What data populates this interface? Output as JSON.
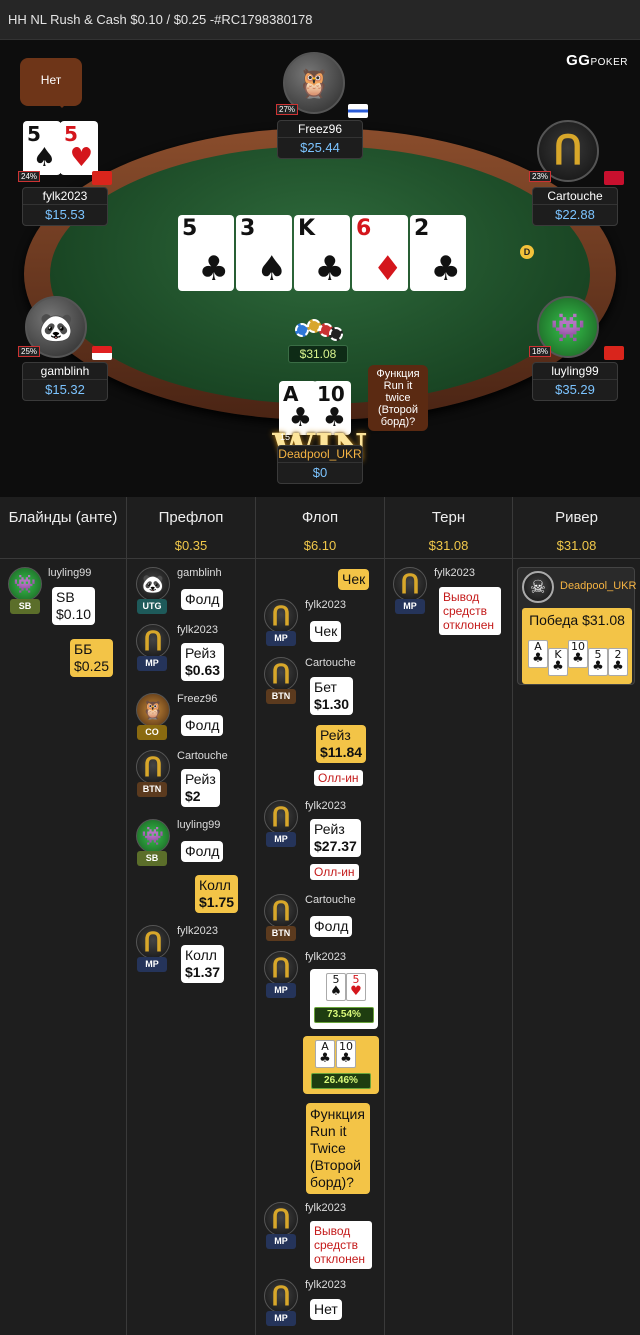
{
  "title": "HH NL Rush & Cash $0.10 / $0.25 -#RC1798380178",
  "logo": {
    "text": "GG",
    "sub": "POKER"
  },
  "bubble_fylk": "Нет",
  "players": {
    "freez": {
      "name": "Freez96",
      "stack": "$25.44",
      "pct": "27%",
      "icon": "owl-icon"
    },
    "fylk": {
      "name": "fylk2023",
      "stack": "$15.53",
      "pct": "24%",
      "cards": [
        {
          "r": "5",
          "s": "♠",
          "red": false
        },
        {
          "r": "5",
          "s": "♥",
          "red": true
        }
      ]
    },
    "cartouche": {
      "name": "Cartouche",
      "stack": "$22.88",
      "pct": "23%",
      "icon": "horseshoe-icon",
      "dealer": "D"
    },
    "gamblinh": {
      "name": "gamblinh",
      "stack": "$15.32",
      "pct": "25%",
      "icon": "panda-icon"
    },
    "luyling": {
      "name": "luyling99",
      "stack": "$35.29",
      "pct": "18%",
      "icon": "alien-icon"
    },
    "deadpool": {
      "name": "Deadpool_UKR",
      "stack": "$0",
      "cards": [
        {
          "r": "A",
          "s": "♣",
          "red": false
        },
        {
          "r": "10",
          "s": "♣",
          "red": false
        }
      ],
      "win": "WIN",
      "win_num": "15"
    }
  },
  "board": [
    {
      "r": "5",
      "s": "♣",
      "red": false
    },
    {
      "r": "3",
      "s": "♠",
      "red": false
    },
    {
      "r": "K",
      "s": "♣",
      "red": false
    },
    {
      "r": "6",
      "s": "♦",
      "red": true
    },
    {
      "r": "2",
      "s": "♣",
      "red": false
    }
  ],
  "pot": "$31.08",
  "rit_bubble": "Функция Run it twice (Второй борд)?",
  "streets": [
    {
      "label": "Блайнды (анте)",
      "amt": ""
    },
    {
      "label": "Префлоп",
      "amt": "$0.35"
    },
    {
      "label": "Флоп",
      "amt": "$6.10"
    },
    {
      "label": "Терн",
      "amt": "$31.08"
    },
    {
      "label": "Ривер",
      "amt": "$31.08"
    }
  ],
  "blinds": {
    "luyling": {
      "name": "luyling99",
      "pos": "SB",
      "action": [
        "SB",
        "$0.10"
      ]
    },
    "bb": [
      "ББ",
      "$0.25"
    ]
  },
  "preflop": [
    {
      "name": "gamblinh",
      "pos": "UTG",
      "action": "Фолд"
    },
    {
      "name": "fylk2023",
      "pos": "MP",
      "action": "Рейз",
      "amount": "$0.63"
    },
    {
      "name": "Freez96",
      "pos": "CO",
      "action": "Фолд"
    },
    {
      "name": "Cartouche",
      "pos": "BTN",
      "action": "Рейз",
      "amount": "$2"
    },
    {
      "name": "luyling99",
      "pos": "SB",
      "action": "Фолд"
    },
    {
      "hero": true,
      "action": "Колл",
      "amount": "$1.75"
    },
    {
      "name": "fylk2023",
      "pos": "MP",
      "action": "Колл",
      "amount": "$1.37"
    }
  ],
  "flop": {
    "hero_check": "Чек",
    "a1": {
      "name": "fylk2023",
      "pos": "MP",
      "action": "Чек"
    },
    "a2": {
      "name": "Cartouche",
      "pos": "BTN",
      "action": "Бет",
      "amount": "$1.30"
    },
    "hero_raise": {
      "action": "Рейз",
      "amount": "$11.84",
      "tag": "Олл-ин"
    },
    "a3": {
      "name": "fylk2023",
      "pos": "MP",
      "action": "Рейз",
      "amount": "$27.37",
      "tag": "Олл-ин"
    },
    "a4": {
      "name": "Cartouche",
      "pos": "BTN",
      "action": "Фолд"
    },
    "show": {
      "name": "fylk2023",
      "pos": "MP",
      "cards": [
        {
          "r": "5",
          "s": "♠",
          "red": false
        },
        {
          "r": "5",
          "s": "♥",
          "red": true
        }
      ],
      "eq": "73.54%"
    },
    "hero_show": {
      "cards": [
        {
          "r": "A",
          "s": "♣",
          "red": false
        },
        {
          "r": "10",
          "s": "♣",
          "red": false
        }
      ],
      "eq": "26.46%"
    },
    "rit": "Функция Run it Twice (Второй борд)?",
    "a5": {
      "name": "fylk2023",
      "pos": "MP",
      "tag": "Вывод средств отклонен"
    },
    "a6": {
      "name": "fylk2023",
      "pos": "MP",
      "action": "Нет"
    }
  },
  "turn": {
    "name": "fylk2023",
    "pos": "MP",
    "tag": "Вывод средств отклонен"
  },
  "river": {
    "name": "Deadpool_UKR",
    "result": "Победа $31.08",
    "cards": [
      {
        "r": "A",
        "s": "♣"
      },
      {
        "r": "K",
        "s": "♣"
      },
      {
        "r": "10",
        "s": "♣"
      },
      {
        "r": "5",
        "s": "♣"
      },
      {
        "r": "2",
        "s": "♣"
      }
    ]
  },
  "colors": {
    "mp": "#25345a",
    "btn": "#5b3a1e",
    "sb": "#5b6e2a",
    "utg": "#1e5a5a",
    "co": "#8a6a10"
  }
}
